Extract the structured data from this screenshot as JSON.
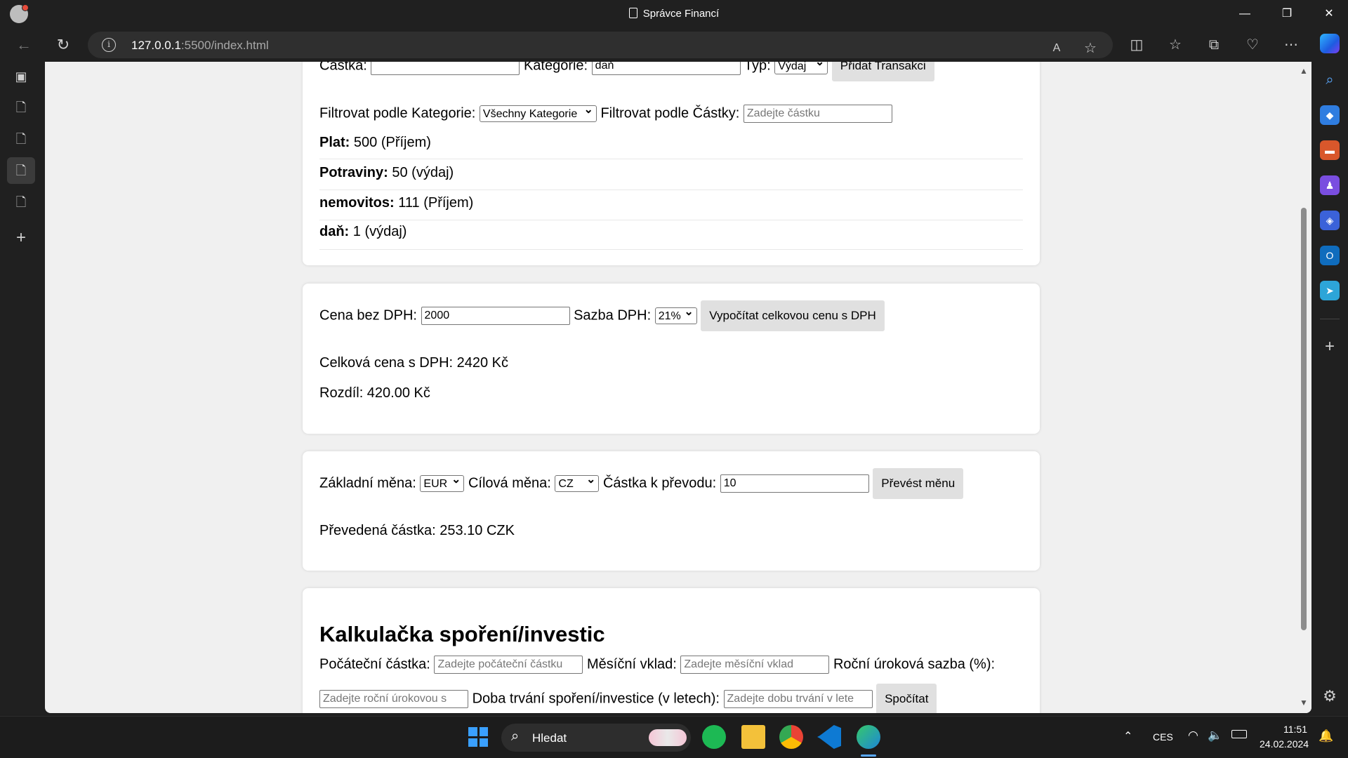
{
  "window": {
    "title": "Správce Financí"
  },
  "browser": {
    "url_host": "127.0.0.1",
    "url_path": ":5500/index.html"
  },
  "transactions": {
    "partial_top_row": {
      "amount_label": "Částka:",
      "category_label": "Kategorie:",
      "category_value": "daň",
      "type_label": "Typ:",
      "type_value": "Výdaj",
      "add_button": "Přidat Transakci"
    },
    "filter_category_label": "Filtrovat podle Kategorie:",
    "filter_category_value": "Všechny Kategorie",
    "filter_amount_label": "Filtrovat podle Částky:",
    "filter_amount_placeholder": "Zadejte částku",
    "items": [
      {
        "name": "Plat:",
        "detail": "500 (Příjem)"
      },
      {
        "name": "Potraviny:",
        "detail": "50 (výdaj)"
      },
      {
        "name": "nemovitos:",
        "detail": "111 (Příjem)"
      },
      {
        "name": "daň:",
        "detail": "1 (výdaj)"
      }
    ]
  },
  "vat": {
    "price_label": "Cena bez DPH:",
    "price_value": "2000",
    "rate_label": "Sazba DPH:",
    "rate_value": "21%",
    "calc_button": "Vypočítat celkovou cenu s DPH",
    "total": "Celková cena s DPH: 2420 Kč",
    "difference": "Rozdíl: 420.00 Kč"
  },
  "currency": {
    "base_label": "Základní měna:",
    "base_value": "EUR",
    "target_label": "Cílová měna:",
    "target_value": "CZ",
    "amount_label": "Částka k převodu:",
    "amount_value": "10",
    "convert_button": "Převést měnu",
    "result": "Převedená částka: 253.10 CZK"
  },
  "savings": {
    "heading": "Kalkulačka spoření/investic",
    "initial_label": "Počáteční částka:",
    "initial_placeholder": "Zadejte počáteční částku",
    "monthly_label": "Měsíční vklad:",
    "monthly_placeholder": "Zadejte měsíční vklad",
    "rate_label": "Roční úroková sazba (%):",
    "rate_placeholder": "Zadejte roční úrokovou s",
    "duration_label": "Doba trvání spoření/investice (v letech):",
    "duration_placeholder": "Zadejte dobu trvání v lete",
    "calc_button": "Spočítat"
  },
  "taskbar": {
    "search_label": "Hledat",
    "language": "CES",
    "time": "11:51",
    "date": "24.02.2024"
  }
}
